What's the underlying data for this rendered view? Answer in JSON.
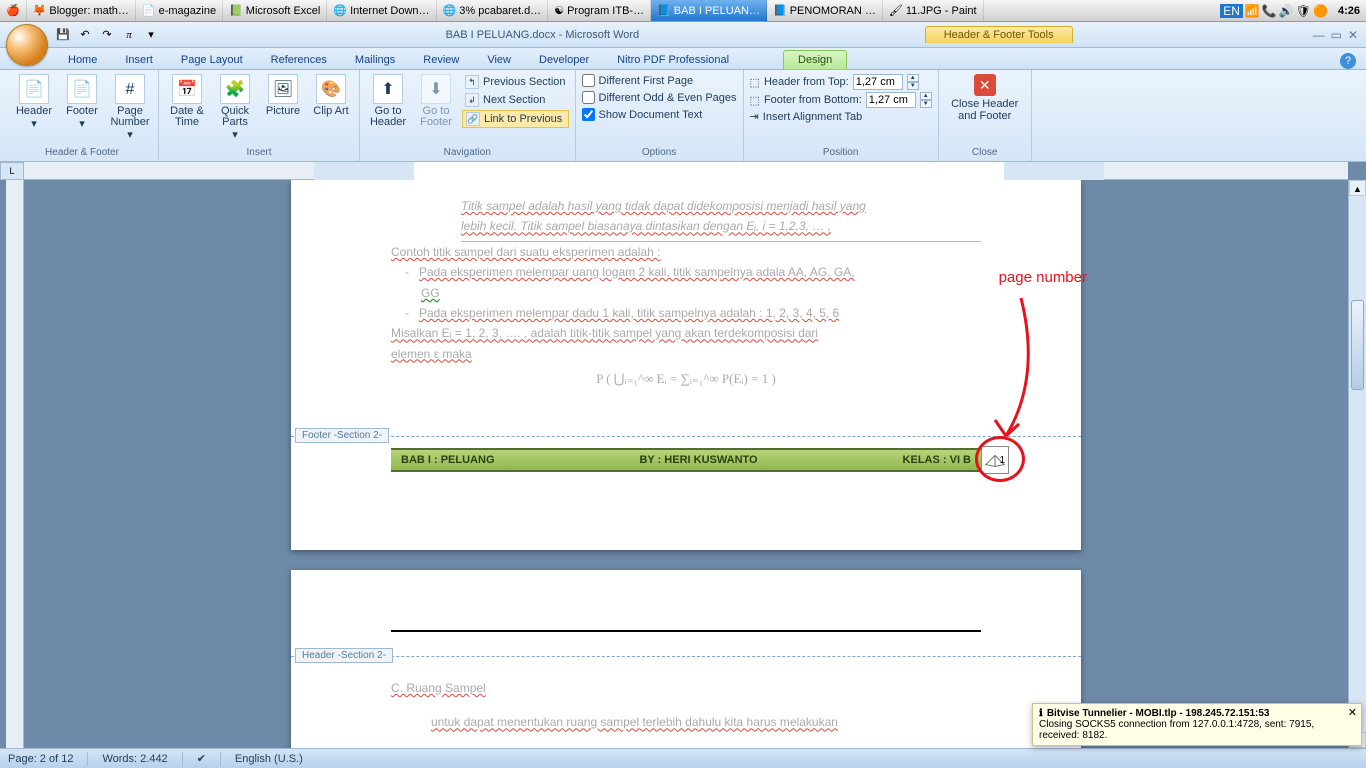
{
  "taskbar": {
    "items": [
      "Blogger: math…",
      "e-magazine",
      "Microsoft Excel",
      "Internet Down…",
      "3% pcabaret.d…",
      "Program ITB-…",
      "BAB I PELUAN…",
      "PENOMORAN …",
      "11.JPG - Paint"
    ],
    "lang": "EN",
    "clock": "4:26"
  },
  "titlebar": {
    "doc": "BAB I PELUANG.docx - Microsoft Word",
    "context": "Header & Footer Tools"
  },
  "tabs": [
    "Home",
    "Insert",
    "Page Layout",
    "References",
    "Mailings",
    "Review",
    "View",
    "Developer",
    "Nitro PDF Professional"
  ],
  "ctxtab": "Design",
  "ribbon": {
    "hf": {
      "header": "Header",
      "footer": "Footer",
      "pagenum": "Page Number",
      "label": "Header & Footer"
    },
    "insert": {
      "date": "Date & Time",
      "quick": "Quick Parts",
      "picture": "Picture",
      "clipart": "Clip Art",
      "label": "Insert"
    },
    "nav": {
      "gohdr": "Go to Header",
      "goftr": "Go to Footer",
      "prev": "Previous Section",
      "next": "Next Section",
      "link": "Link to Previous",
      "label": "Navigation"
    },
    "options": {
      "diffFirst": "Different First Page",
      "diffOdd": "Different Odd & Even Pages",
      "showDoc": "Show Document Text",
      "label": "Options"
    },
    "position": {
      "fromTop": "Header from Top:",
      "fromBottom": "Footer from Bottom:",
      "insertTab": "Insert Alignment Tab",
      "val": "1,27 cm",
      "label": "Position"
    },
    "close": {
      "btn": "Close Header and Footer",
      "label": "Close"
    }
  },
  "doc": {
    "line1": "Titik sampel adalah hasil yang tidak dapat didekomposisi menjadi hasil yang",
    "line2": "lebih kecil. Titik sampel biasanaya dintasikan dengan Eᵢ, i = 1,2,3, … ,",
    "line3": "Contoh titik sampel dari suatu eksperimen adalah :",
    "line4": "Pada eksperimen melempar uang logam 2 kali, titik sampelnya adala AA, AG, GA,",
    "line4b": "GG",
    "line5": "Pada eksperimen melempar dadu 1 kali, titik sampelnya adalah : 1, 2, 3, 4, 5, 6",
    "line6": "Misalkan Eᵢ = 1, 2, 3, …. , adalah titik-titik sampel yang akan terdekomposisi dari",
    "line7": "elemen ε maka",
    "formula": "P ( ⋃ᵢ₌₁^∞ Eᵢ = ∑ᵢ₌₁^∞ P(Eᵢ) = 1 )",
    "footerLabel": "Footer -Section 2-",
    "headerLabel": "Header -Section 2-",
    "f1": "BAB I : PELUANG",
    "f2": "BY : HERI KUSWANTO",
    "f3": "KELAS : VI B",
    "pagenum": "1",
    "sec2a": "C.    Ruang Sampel",
    "sec2b": "untuk dapat menentukan ruang sampel terlebih dahulu kita harus melakukan"
  },
  "annot": {
    "text": "page number"
  },
  "status": {
    "page": "Page: 2 of 12",
    "words": "Words: 2.442",
    "lang": "English (U.S.)"
  },
  "toast": {
    "title": "Bitvise Tunnelier - MOBI.tlp - 198.245.72.151:53",
    "body": "Closing SOCKS5 connection from 127.0.0.1:4728, sent: 7915, received: 8182."
  }
}
